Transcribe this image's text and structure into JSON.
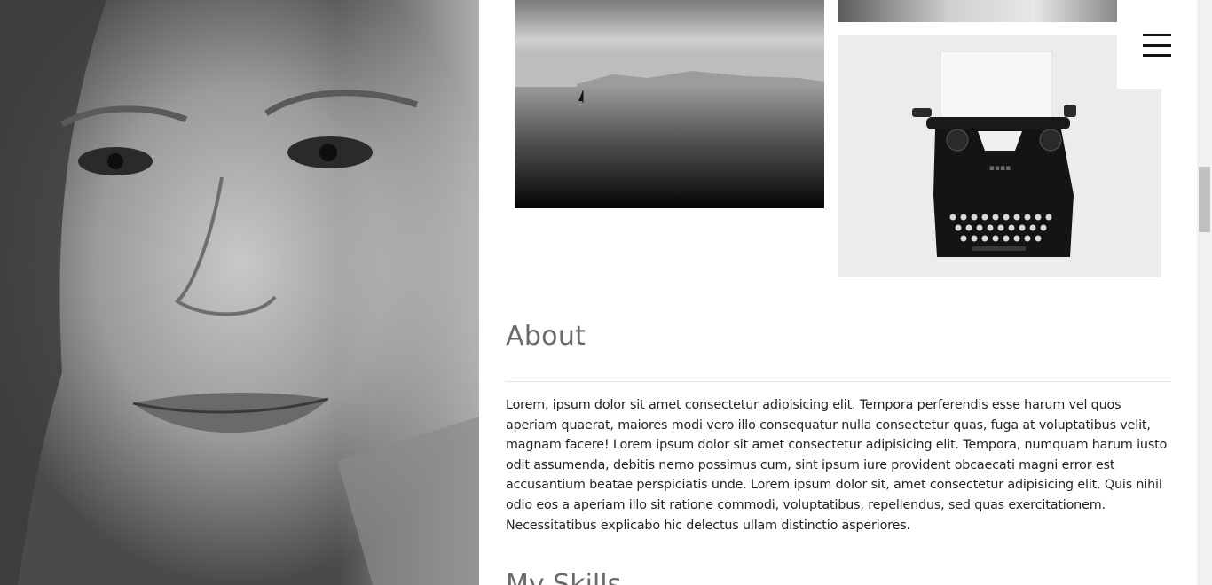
{
  "images": {
    "portrait": "portrait-photo",
    "sea": "sea-photo",
    "strip": "cropped-photo",
    "typewriter": "typewriter-photo"
  },
  "menu": {
    "icon": "hamburger-icon"
  },
  "about": {
    "title": "About",
    "text": "Lorem, ipsum dolor sit amet consectetur adipisicing elit. Tempora perferendis esse harum vel quos aperiam quaerat, maiores modi vero illo consequatur nulla consectetur quas, fuga at voluptatibus velit, magnam facere! Lorem ipsum dolor sit amet consectetur adipisicing elit. Tempora, numquam harum iusto odit assumenda, debitis nemo possimus cum, sint ipsum iure provident obcaecati magni error est accusantium beatae perspiciatis unde. Lorem ipsum dolor sit, amet consectetur adipisicing elit. Quis nihil odio eos a aperiam illo sit ratione commodi, voluptatibus, repellendus, sed quas exercitationem. Necessitatibus explicabo hic delectus ullam distinctio asperiores."
  },
  "skills": {
    "title": "My Skills"
  }
}
